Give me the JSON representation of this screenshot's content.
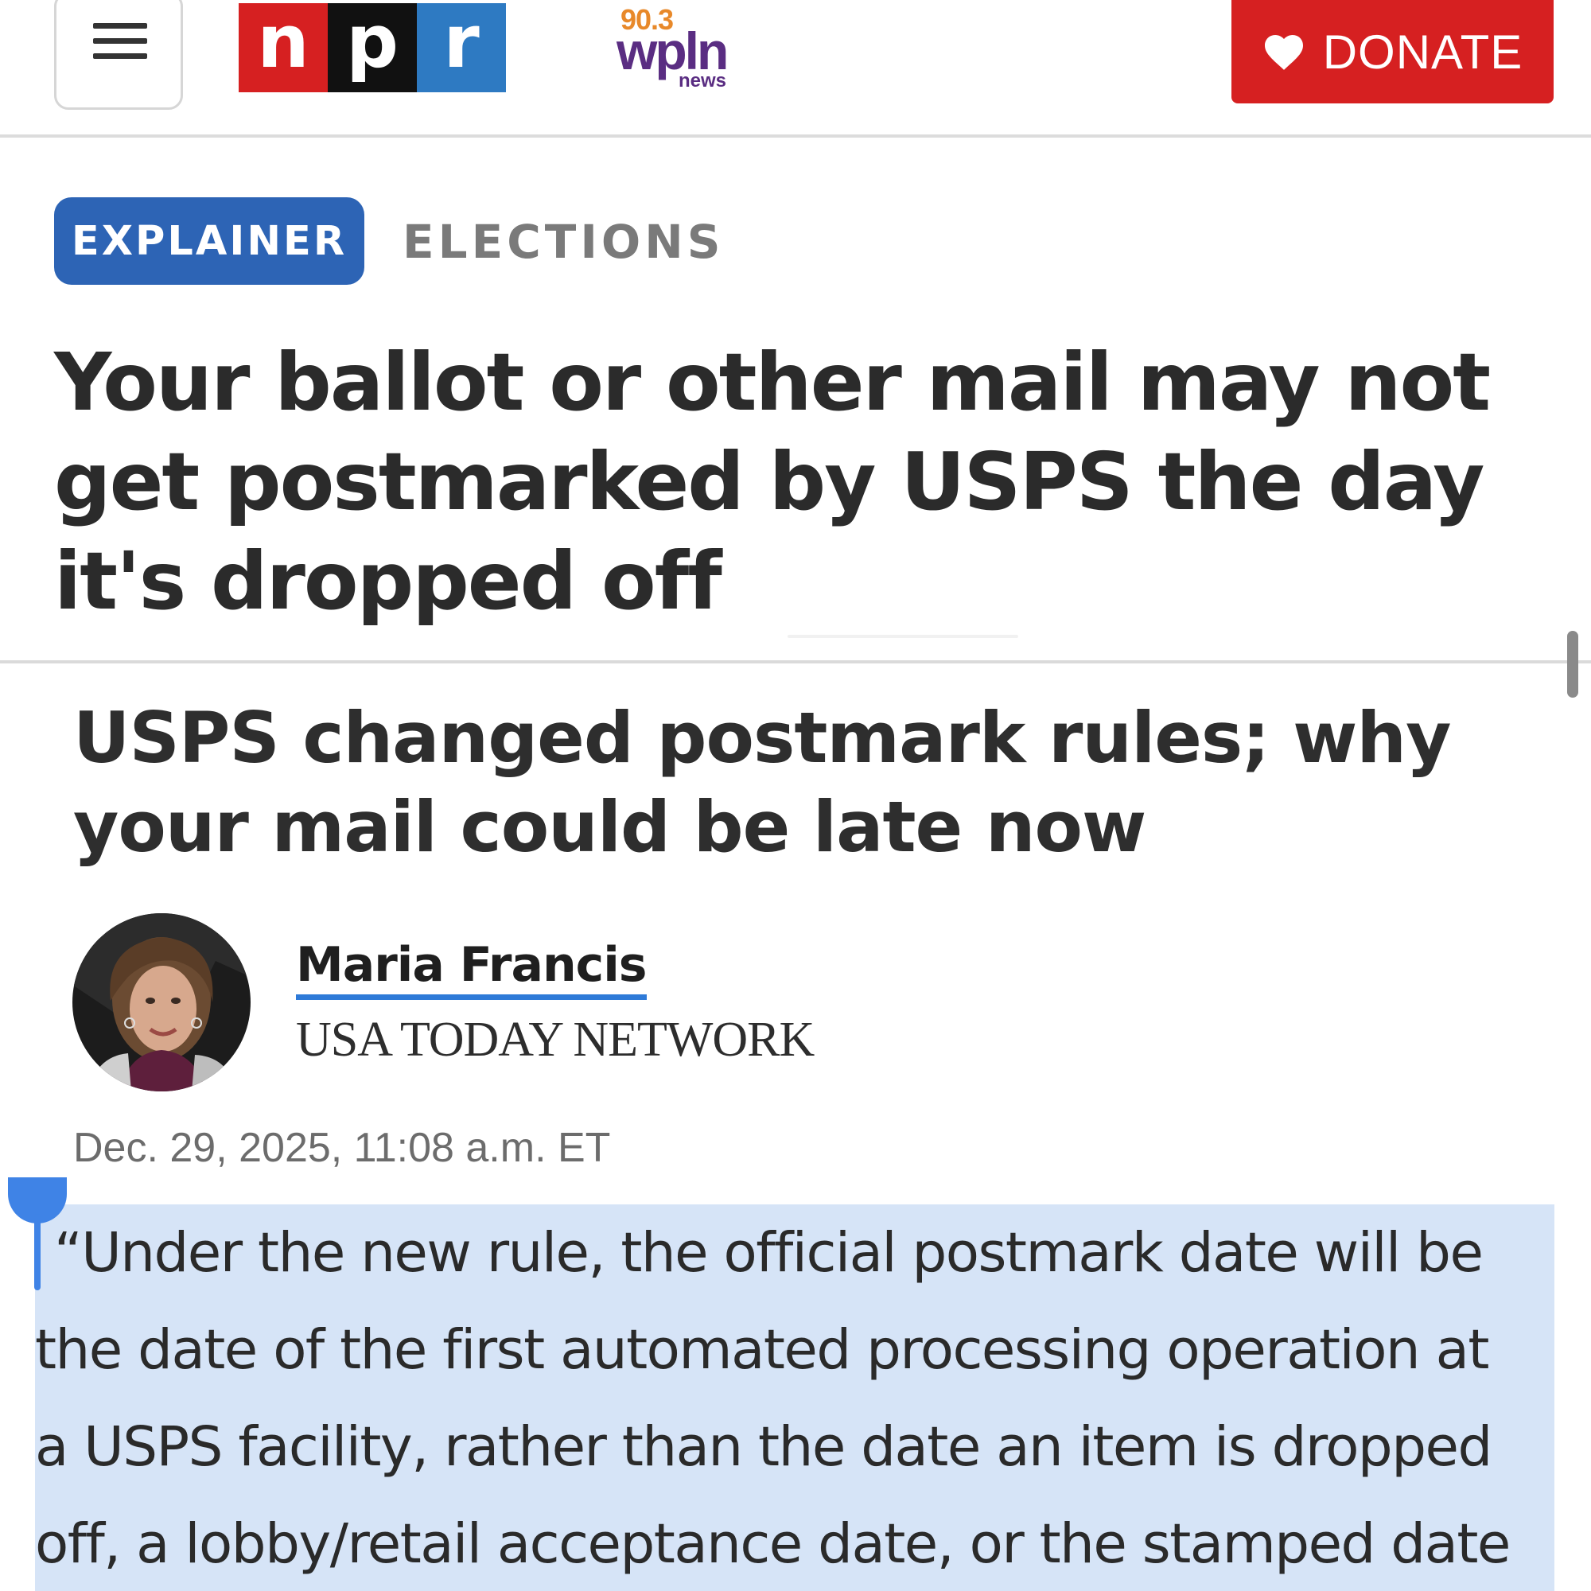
{
  "header": {
    "menu_icon": "hamburger-menu-icon",
    "npr_logo": {
      "letters": [
        "n",
        "p",
        "r"
      ],
      "colors": [
        "#d62021",
        "#111111",
        "#2e7ac2"
      ]
    },
    "station_logo": {
      "frequency": "90.3",
      "call_sign": "wpln",
      "suffix": "news",
      "colors": {
        "frequency": "#e8892a",
        "call_sign": "#5a2d82"
      }
    },
    "donate": {
      "label": "DONATE",
      "icon": "heart-icon",
      "color": "#d62021"
    }
  },
  "article": {
    "tags": {
      "primary": "EXPLAINER",
      "section": "ELECTIONS",
      "primary_color": "#2d64b5"
    },
    "headline": "Your ballot or other mail may not get postmarked by USPS the day it's dropped off",
    "subheadline": "USPS changed postmark rules; why your mail could be late now",
    "byline": {
      "author": "Maria Francis",
      "publication": "USA TODAY NETWORK",
      "link_underline_color": "#2e7ad8"
    },
    "timestamp": "Dec. 29, 2025, 11:08 a.m. ET",
    "body": {
      "selected": true,
      "selection_color": "#d6e4f7",
      "lines": [
        "“Under the new rule, the official postmark date will be",
        "the date of the first automated processing operation at",
        "a USPS facility, rather than the date an item is dropped",
        "off, a lobby/retail acceptance date, or the stamped date"
      ]
    }
  }
}
